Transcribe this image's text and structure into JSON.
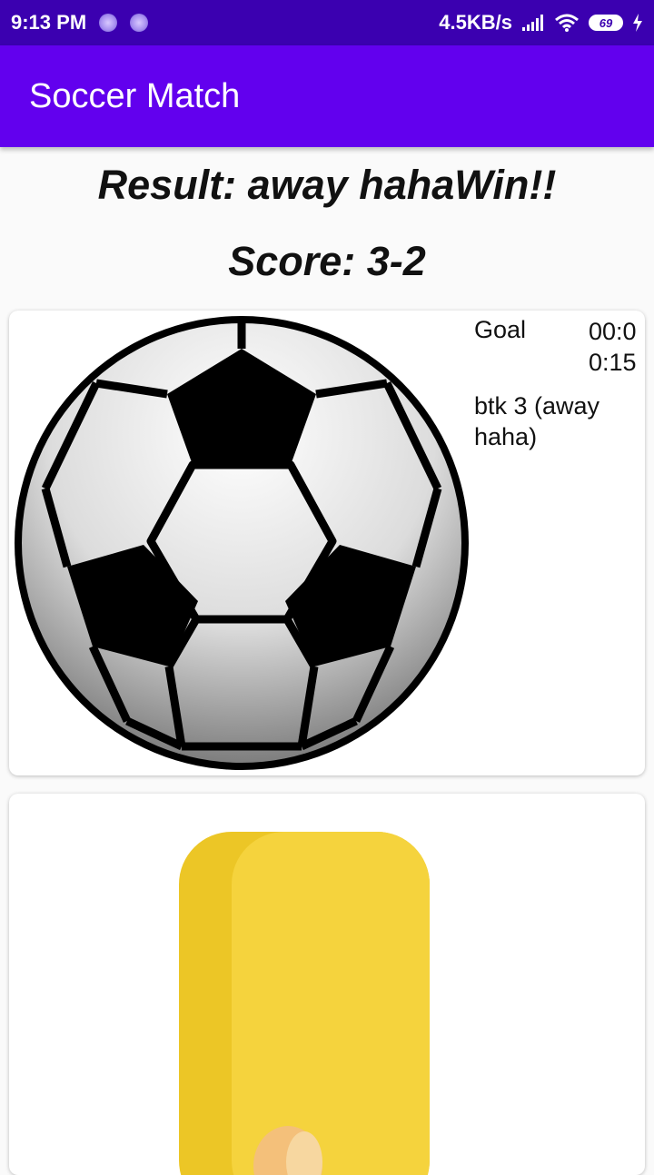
{
  "status_bar": {
    "time": "9:13 PM",
    "network_speed": "4.5KB/s",
    "battery_level": "69",
    "icons": [
      "notification-dot-icon",
      "notification-dot-icon",
      "signal-icon",
      "wifi-icon",
      "battery-icon",
      "charging-bolt-icon"
    ]
  },
  "app_bar": {
    "title": "Soccer Match",
    "color": "#6200ee"
  },
  "match": {
    "result": "Result: away hahaWin!!",
    "score": "Score: 3-2"
  },
  "events": [
    {
      "icon": "soccer-ball-icon",
      "type": "Goal",
      "time": "00:00:15",
      "description": "btk 3 (away haha)"
    },
    {
      "icon": "yellow-card-icon"
    }
  ]
}
